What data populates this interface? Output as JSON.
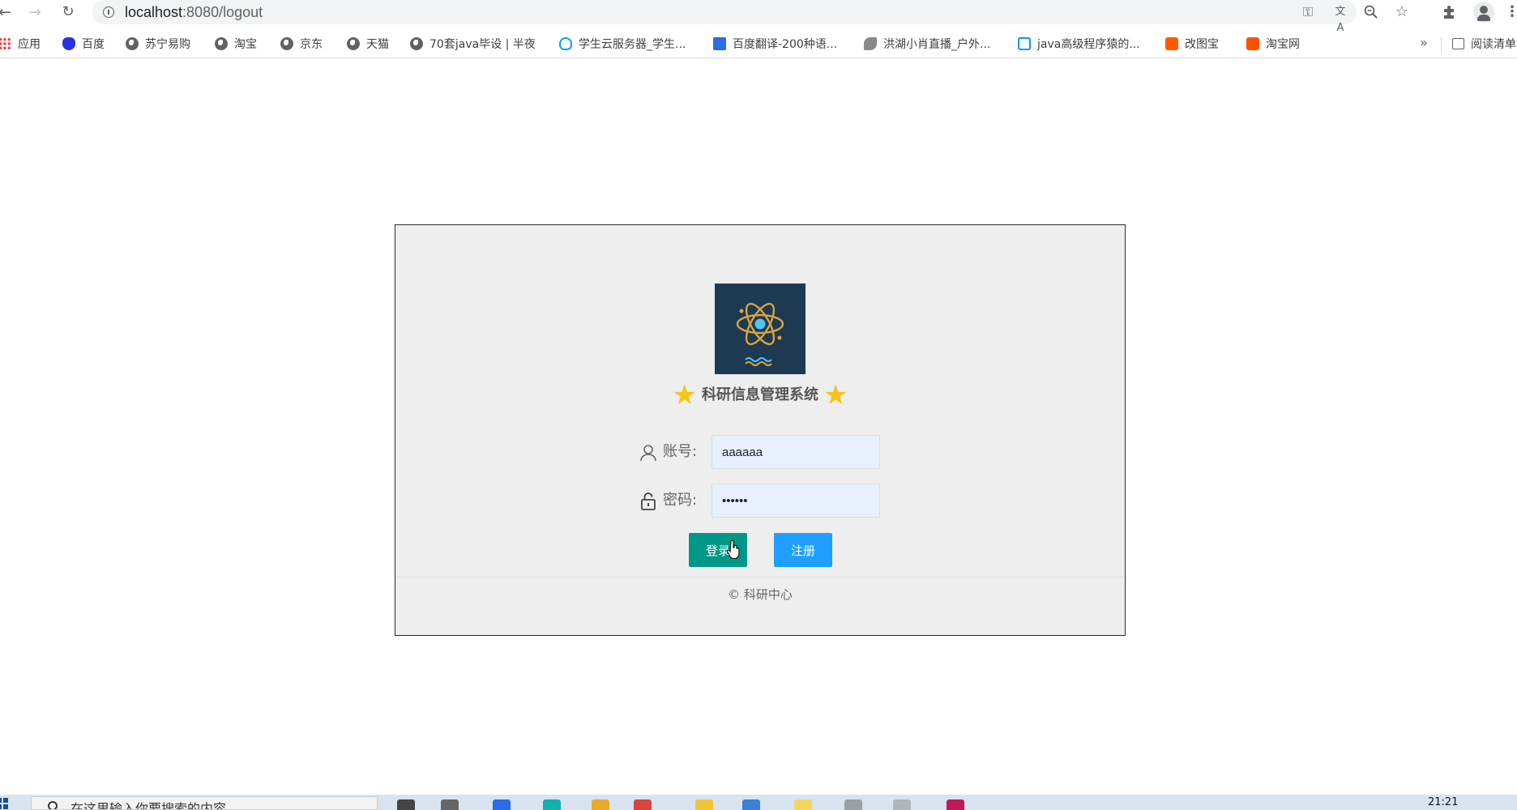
{
  "browser": {
    "url_host": "localhost",
    "url_path": ":8080/logout",
    "nav": {
      "back": "←",
      "forward": "→",
      "reload": "↻"
    }
  },
  "bookmarks": [
    {
      "label": "应用",
      "icon": "apps-icon"
    },
    {
      "label": "百度",
      "icon": "baidu-icon",
      "color": "#2932e1"
    },
    {
      "label": "苏宁易购",
      "icon": "globe-icon"
    },
    {
      "label": "淘宝",
      "icon": "globe-icon"
    },
    {
      "label": "京东",
      "icon": "globe-icon"
    },
    {
      "label": "天猫",
      "icon": "globe-icon"
    },
    {
      "label": "70套java毕设 | 半夜",
      "icon": "globe-icon"
    },
    {
      "label": "学生云服务器_学生...",
      "icon": "cloud-icon",
      "color": "#00a3e0"
    },
    {
      "label": "百度翻译-200种语...",
      "icon": "translate-icon",
      "color": "#2b6de5"
    },
    {
      "label": "洪湖小肖直播_户外...",
      "icon": "rocket-icon"
    },
    {
      "label": "java高级程序猿的...",
      "icon": "bilibili-icon",
      "color": "#00a1d6"
    },
    {
      "label": "改图宝",
      "icon": "gaitubao-icon",
      "color": "#ff5a00"
    },
    {
      "label": "淘宝网",
      "icon": "taobao-icon",
      "color": "#ff5000"
    }
  ],
  "bookmarks_overflow": "»",
  "reading_list": "阅读清单",
  "login": {
    "title": "科研信息管理系统",
    "star": "★",
    "username_label": "账号:",
    "username_value": "aaaaaa",
    "password_label": "密码:",
    "password_value": "aaaaaa",
    "login_button": "登录",
    "register_button": "注册",
    "copyright": "© 科研中心",
    "colors": {
      "login": "#009688",
      "register": "#1e9fff",
      "logo_bg": "#1e3a52",
      "star": "#f5c518"
    }
  },
  "taskbar": {
    "search_placeholder": "在这里输入你要搜索的内容",
    "clock": "21:21"
  }
}
